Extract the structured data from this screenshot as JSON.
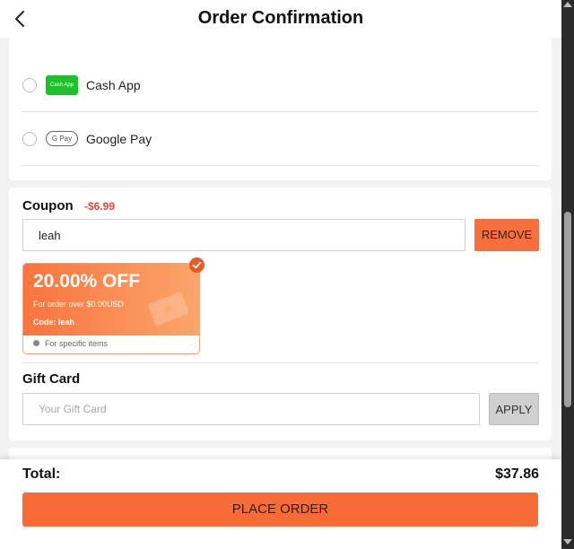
{
  "header": {
    "title": "Order Confirmation",
    "back_icon": "chevron-left-icon"
  },
  "payment_methods": [
    {
      "label": "Cash App",
      "logo_text": "Cash App",
      "logo_color": "#1ec02b",
      "selected": false
    },
    {
      "label": "Google Pay",
      "logo_text": "G Pay",
      "selected": false
    }
  ],
  "coupon": {
    "title": "Coupon",
    "discount": "-$6.99",
    "input_value": "leah",
    "remove_label": "REMOVE",
    "ticket": {
      "off_text": "20.00% OFF",
      "condition": "For order over $0.00USD",
      "code": "Code: leah",
      "note": "For specific items",
      "selected": true
    }
  },
  "gift_card": {
    "title": "Gift Card",
    "placeholder": "Your Gift Card",
    "apply_label": "APPLY"
  },
  "footer": {
    "total_label": "Total:",
    "total_value": "$37.86",
    "place_order_label": "PLACE ORDER"
  },
  "colors": {
    "accent": "#f76b37",
    "discount_red": "#e4473b",
    "disabled_button": "#cfcfcf"
  }
}
